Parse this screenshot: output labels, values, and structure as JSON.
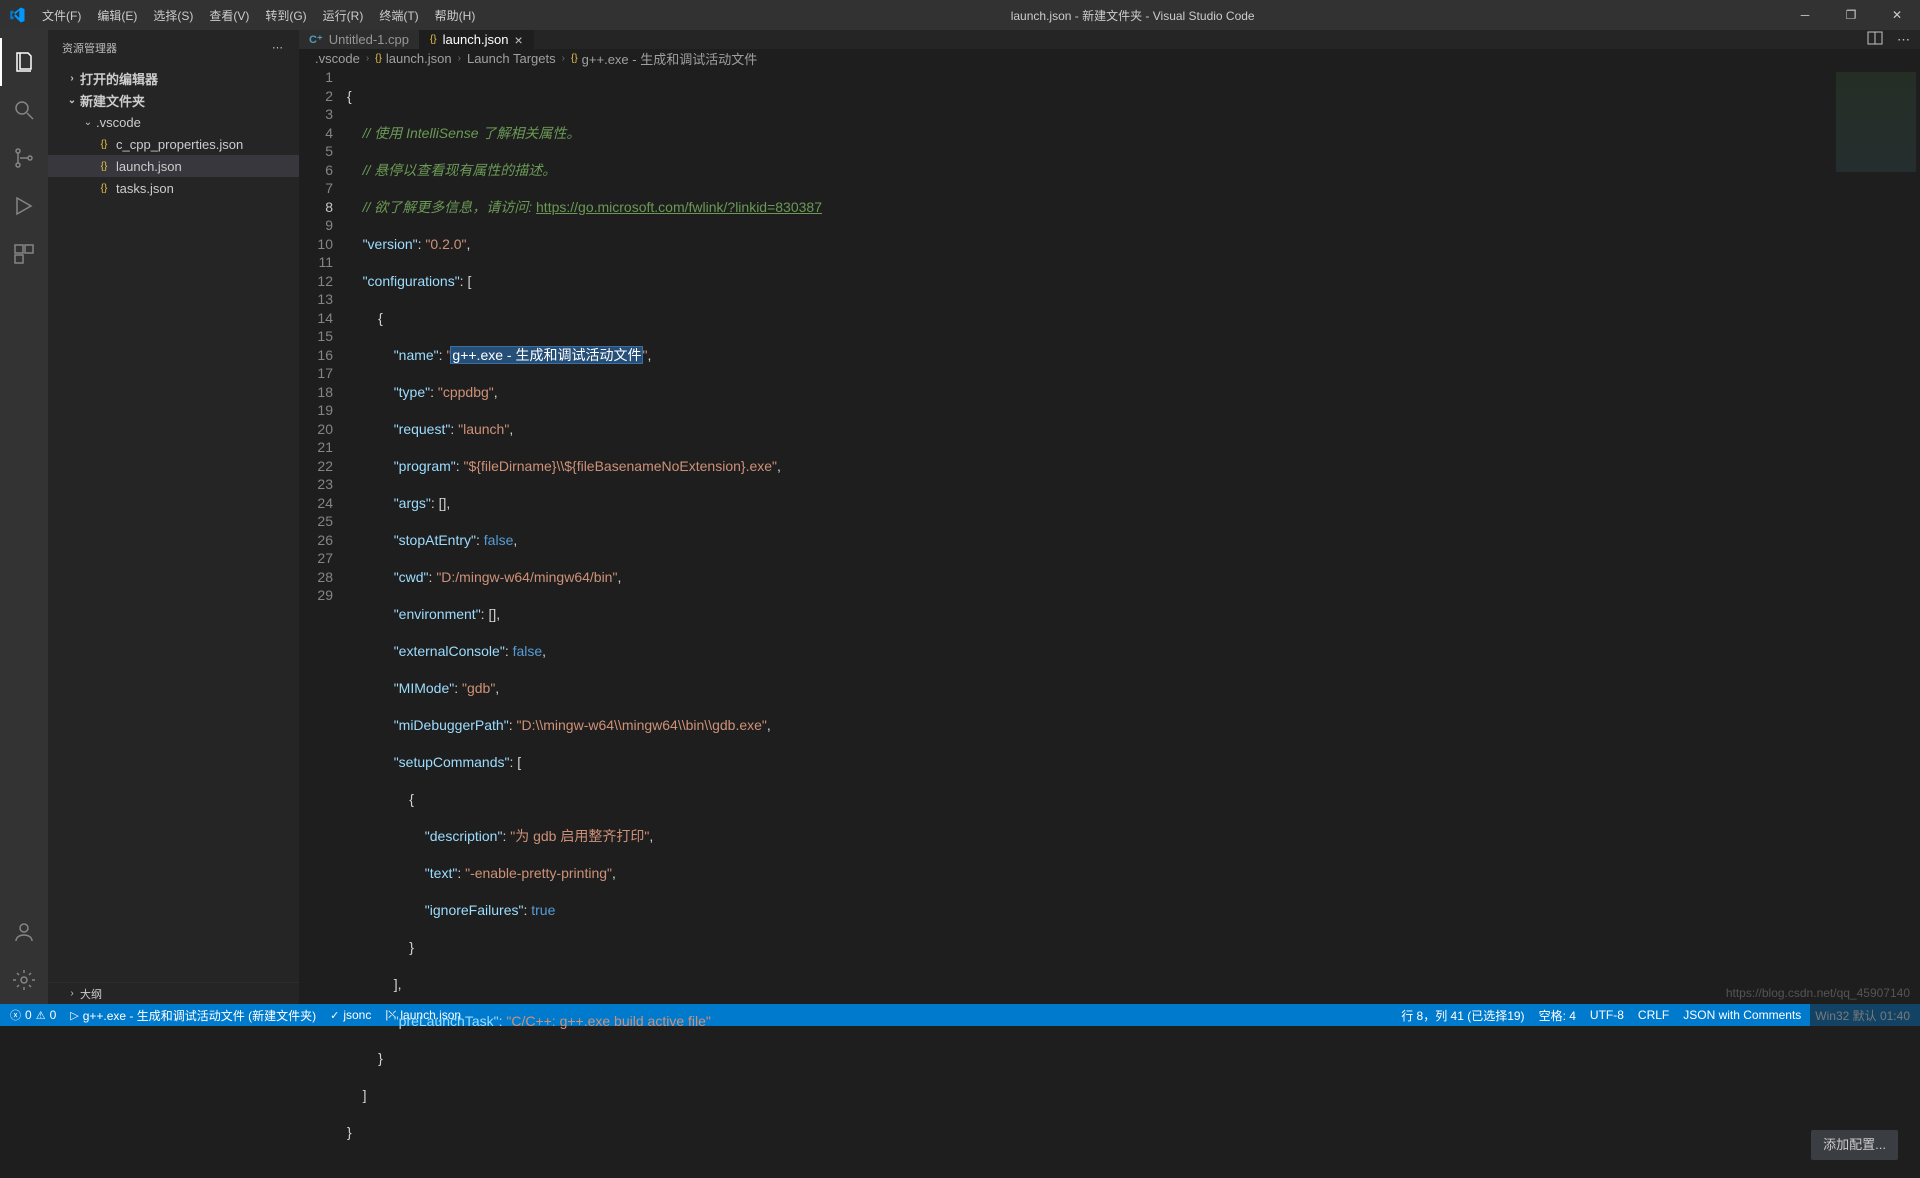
{
  "window": {
    "title": "launch.json - 新建文件夹 - Visual Studio Code"
  },
  "menu": [
    "文件(F)",
    "编辑(E)",
    "选择(S)",
    "查看(V)",
    "转到(G)",
    "运行(R)",
    "终端(T)",
    "帮助(H)"
  ],
  "sidebar": {
    "title": "资源管理器",
    "sections": {
      "opened": "打开的编辑器",
      "folder": "新建文件夹",
      "vscode": ".vscode"
    },
    "files": [
      "c_cpp_properties.json",
      "launch.json",
      "tasks.json"
    ],
    "outline": "大纲"
  },
  "tabs": {
    "untitled": "Untitled-1.cpp",
    "launch": "launch.json"
  },
  "breadcrumbs": {
    "a": ".vscode",
    "b": "launch.json",
    "c": "Launch Targets",
    "d": "g++.exe - 生成和调试活动文件"
  },
  "code": {
    "c1": "// 使用 IntelliSense 了解相关属性。",
    "c2": "// 悬停以查看现有属性的描述。",
    "c3_a": "// 欲了解更多信息，请访问: ",
    "c3_b": "https://go.microsoft.com/fwlink/?linkid=830387",
    "k_version": "\"version\"",
    "v_version": "\"0.2.0\"",
    "k_configs": "\"configurations\"",
    "k_name": "\"name\"",
    "v_name_a": "\"",
    "v_name_sel": "g++.exe - 生成和调试活动文件",
    "v_name_b": "\"",
    "k_type": "\"type\"",
    "v_type": "\"cppdbg\"",
    "k_request": "\"request\"",
    "v_request": "\"launch\"",
    "k_program": "\"program\"",
    "v_program": "\"${fileDirname}\\\\${fileBasenameNoExtension}.exe\"",
    "k_args": "\"args\"",
    "k_stop": "\"stopAtEntry\"",
    "v_false": "false",
    "k_cwd": "\"cwd\"",
    "v_cwd": "\"D:/mingw-w64/mingw64/bin\"",
    "k_env": "\"environment\"",
    "k_ext": "\"externalConsole\"",
    "k_mimode": "\"MIMode\"",
    "v_mimode": "\"gdb\"",
    "k_midbg": "\"miDebuggerPath\"",
    "v_midbg": "\"D:\\\\mingw-w64\\\\mingw64\\\\bin\\\\gdb.exe\"",
    "k_setup": "\"setupCommands\"",
    "k_desc": "\"description\"",
    "v_desc": "\"为 gdb 启用整齐打印\"",
    "k_text": "\"text\"",
    "v_text": "\"-enable-pretty-printing\"",
    "k_ignore": "\"ignoreFailures\"",
    "v_true": "true",
    "k_prelaunch": "\"preLaunchTask\"",
    "v_prelaunch": "\"C/C++: g++.exe build active file\""
  },
  "button": {
    "add_config": "添加配置..."
  },
  "statusbar": {
    "errors": "0",
    "warnings": "0",
    "build_target": "g++.exe - 生成和调试活动文件 (新建文件夹)",
    "check": "jsonc",
    "radio": "launch.json",
    "cursor": "行 8，列 41 (已选择19)",
    "spaces": "空格: 4",
    "encoding": "UTF-8",
    "eol": "CRLF",
    "lang": "JSON with Comments",
    "extra": "Win32 默认 01:40"
  },
  "watermark": "https://blog.csdn.net/qq_45907140"
}
